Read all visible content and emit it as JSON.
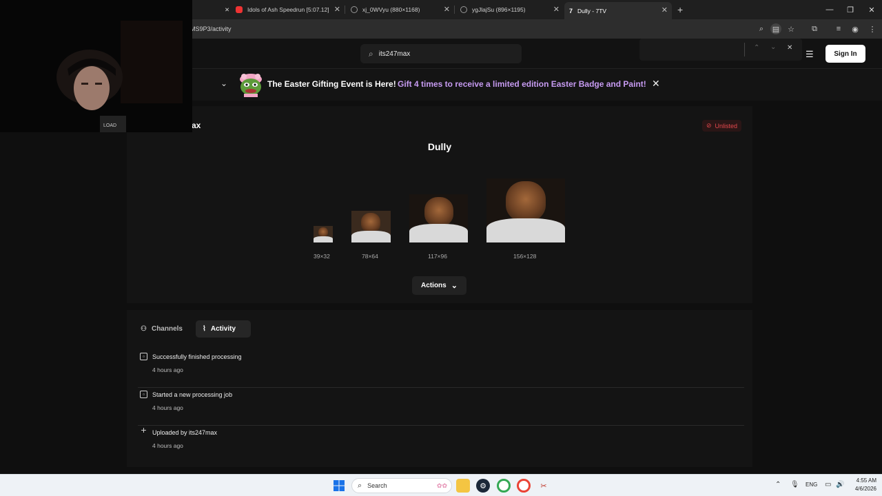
{
  "browser": {
    "tabs": [
      {
        "label": "Idols of Ash Speedrun [5:07.12]",
        "icon": "youtube-icon"
      },
      {
        "label": "xj_0WVyu (880×1168)",
        "icon": "globe-icon"
      },
      {
        "label": "ygJlajSu (896×1195)",
        "icon": "globe-icon"
      },
      {
        "label": "Dully - 7TV",
        "icon": "7tv-icon"
      }
    ],
    "new_tab": "+",
    "address": "VMS9P3/activity",
    "window": {
      "minimize": "—",
      "restore": "❐",
      "close": "✕"
    }
  },
  "site": {
    "search_value": "its247max",
    "signin_label": "Sign In",
    "find": {
      "up": "⌃",
      "down": "⌄",
      "close": "✕"
    }
  },
  "banner": {
    "title": "The Easter Gifting Event is Here!",
    "subtitle": "Gift 4 times to receive a limited edition Easter Badge and Paint!"
  },
  "emote": {
    "owner_fragment": "ax",
    "status": "Unlisted",
    "name": "Dully",
    "sizes": [
      "39×32",
      "78×64",
      "117×96",
      "156×128"
    ],
    "actions_label": "Actions"
  },
  "tabs": {
    "channels": "Channels",
    "activity": "Activity"
  },
  "activity": [
    {
      "title": "Successfully finished processing",
      "time": "4 hours ago",
      "icon": "processing-icon"
    },
    {
      "title": "Started a new processing job",
      "time": "4 hours ago",
      "icon": "processing-icon"
    },
    {
      "title": "Uploaded by its247max",
      "time": "4 hours ago",
      "icon": "plus-icon"
    }
  ],
  "taskbar": {
    "search_label": "Search",
    "lang": "ENG",
    "time": "4:55 AM",
    "date": "4/6/2026"
  },
  "colors": {
    "accent_purple": "#c79bf2",
    "unlisted_red": "#e5484d",
    "background": "#0f0f0f",
    "card": "#141414"
  }
}
